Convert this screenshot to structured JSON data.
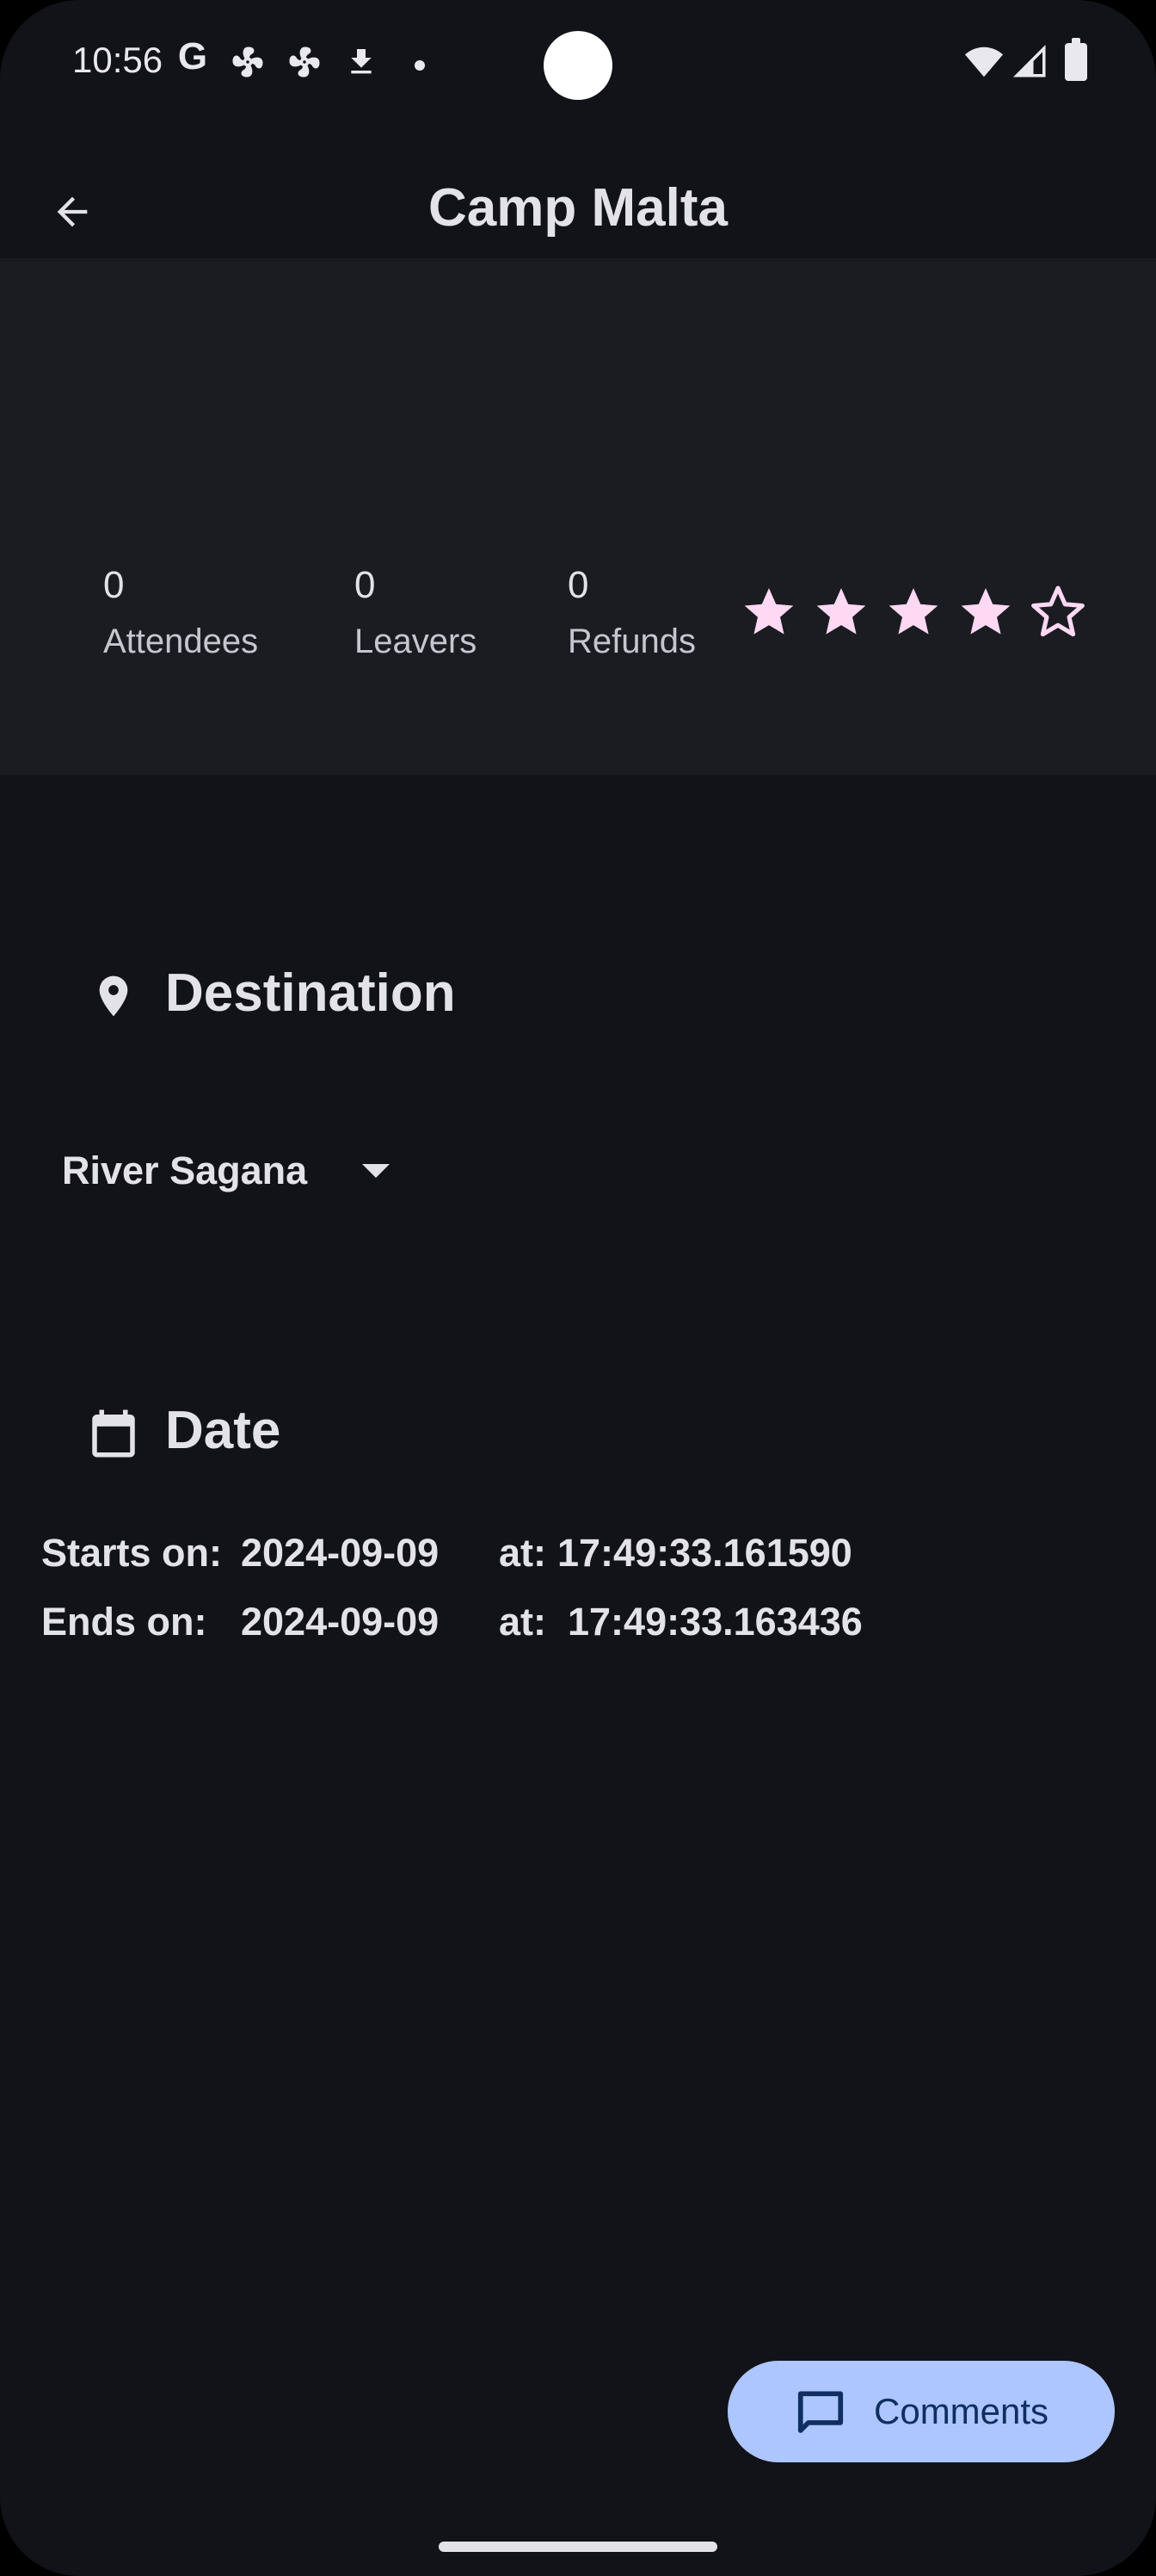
{
  "status_bar": {
    "time": "10:56",
    "google_letter": "G",
    "icons": [
      "google-icon",
      "fan-icon",
      "fan-icon",
      "download-icon",
      "notification-dot-icon",
      "wifi-icon",
      "cellular-signal-icon",
      "battery-icon"
    ]
  },
  "header": {
    "title": "Camp Malta",
    "back_icon": "arrow-left-icon"
  },
  "stats": {
    "attendees": {
      "value": "0",
      "label": "Attendees"
    },
    "leavers": {
      "value": "0",
      "label": "Leavers"
    },
    "refunds": {
      "value": "0",
      "label": "Refunds"
    },
    "rating": {
      "filled": 4,
      "total": 5
    }
  },
  "destination": {
    "title": "Destination",
    "icon": "location-pin-icon",
    "selected": "River Sagana"
  },
  "date": {
    "title": "Date",
    "icon": "calendar-icon",
    "start": {
      "label": "Starts on:",
      "date": "2024-09-09",
      "at_label": "at:",
      "time": "17:49:33.161590"
    },
    "end": {
      "label": "Ends on:",
      "date": "2024-09-09",
      "at_label": "at:",
      "time": "17:49:33.163436"
    }
  },
  "fab": {
    "label": "Comments",
    "icon": "comment-icon"
  },
  "colors": {
    "background": "#121318",
    "panel": "#1b1c21",
    "text": "#e3e2e9",
    "star": "#ffd8f4",
    "fab_bg": "#adc6ff",
    "fab_text": "#102f60"
  }
}
